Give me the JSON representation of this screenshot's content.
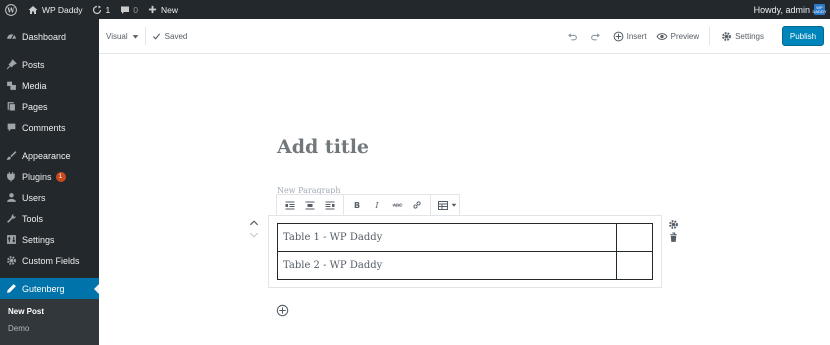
{
  "topbar": {
    "site_name": "WP Daddy",
    "updates_count": "1",
    "comments_count": "0",
    "new_label": "New",
    "greeting": "Howdy, admin",
    "avatar_text": "WP DADDY"
  },
  "sidebar": {
    "items": [
      {
        "label": "Dashboard",
        "icon": "dashboard-icon"
      },
      {
        "label": "Posts",
        "icon": "pin-icon"
      },
      {
        "label": "Media",
        "icon": "media-icon"
      },
      {
        "label": "Pages",
        "icon": "pages-icon"
      },
      {
        "label": "Comments",
        "icon": "comment-icon"
      },
      {
        "label": "Appearance",
        "icon": "brush-icon"
      },
      {
        "label": "Plugins",
        "icon": "plugin-icon",
        "badge": "1"
      },
      {
        "label": "Users",
        "icon": "users-icon"
      },
      {
        "label": "Tools",
        "icon": "wrench-icon"
      },
      {
        "label": "Settings",
        "icon": "settings-icon"
      },
      {
        "label": "Custom Fields",
        "icon": "gear-icon"
      },
      {
        "label": "Gutenberg",
        "icon": "pencil-icon",
        "active": true
      }
    ],
    "submenu": [
      {
        "label": "New Post",
        "current": true
      },
      {
        "label": "Demo"
      }
    ]
  },
  "header": {
    "mode_label": "Visual",
    "saved_label": "Saved",
    "insert_label": "Insert",
    "preview_label": "Preview",
    "settings_label": "Settings",
    "publish_label": "Publish"
  },
  "editor": {
    "title_placeholder": "Add title",
    "paragraph_hint": "New Paragraph",
    "table": [
      [
        "Table 1 - WP Daddy",
        ""
      ],
      [
        "Table 2 - WP Daddy",
        ""
      ]
    ]
  },
  "colors": {
    "admin_bar": "#23282d",
    "accent": "#0073aa",
    "publish": "#0085ba",
    "badge": "#ca4a1f"
  }
}
